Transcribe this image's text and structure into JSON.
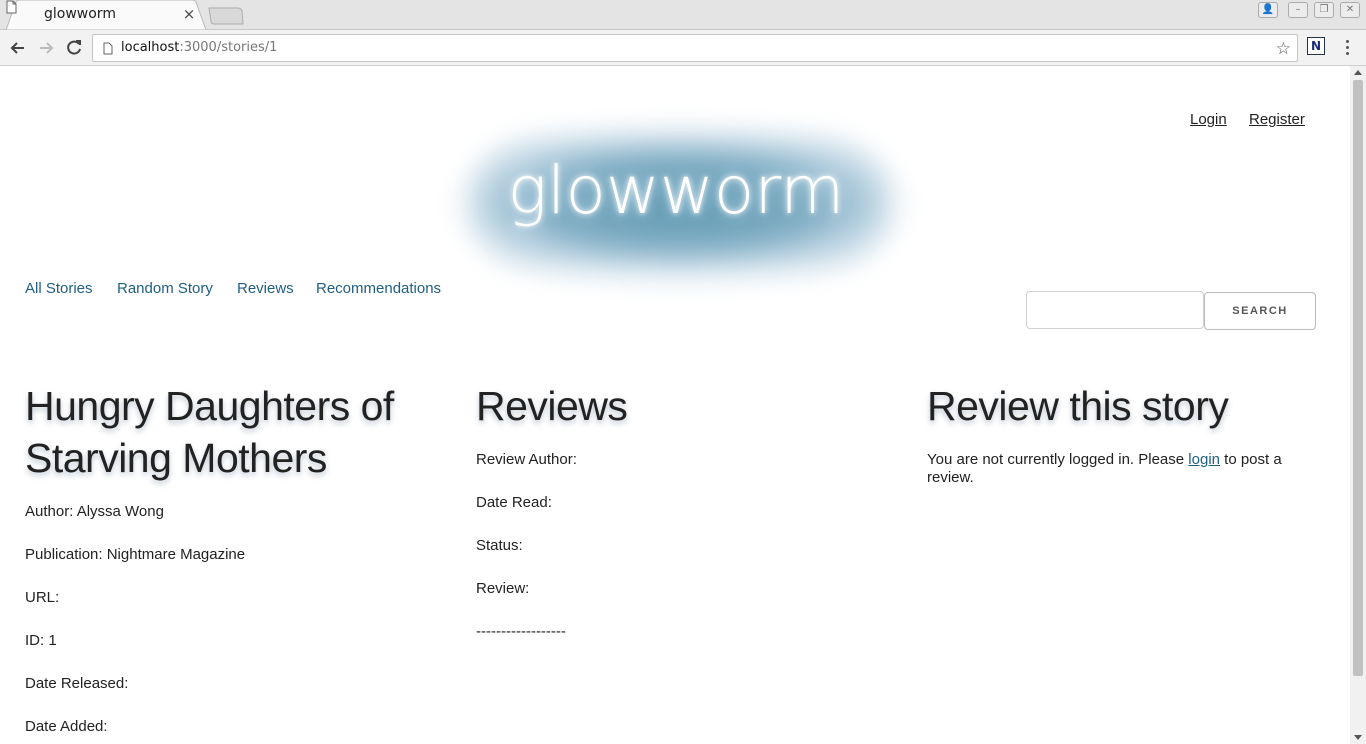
{
  "browser": {
    "tab_title": "glowworm",
    "tab_close": "×",
    "url_host": "localhost",
    "url_rest": ":3000/stories/1",
    "extension_label": "N",
    "star_icon": "☆"
  },
  "header": {
    "login_label": "Login",
    "register_label": "Register",
    "logo_text": "glowworm"
  },
  "nav": {
    "items": [
      {
        "label": "All Stories"
      },
      {
        "label": "Random Story"
      },
      {
        "label": "Reviews"
      },
      {
        "label": "Recommendations"
      }
    ]
  },
  "search": {
    "placeholder": "",
    "button_label": "SEARCH"
  },
  "story": {
    "title": "Hungry Daughters of Starving Mothers",
    "author": "Author: Alyssa Wong",
    "publication": "Publication: Nightmare Magazine",
    "url": "URL:",
    "id": "ID: 1",
    "date_released": "Date Released:",
    "date_added": "Date Added:"
  },
  "reviews": {
    "heading": "Reviews",
    "author": "Review Author:",
    "date_read": "Date Read:",
    "status": "Status:",
    "review": "Review:",
    "separator": "------------------"
  },
  "review_form": {
    "heading": "Review this story",
    "note_prefix": "You are not currently logged in. Please ",
    "login_link": "login",
    "note_suffix": " to post a review."
  },
  "colors": {
    "link": "#1f5f80",
    "logo_glow": "#5f9ab3"
  }
}
